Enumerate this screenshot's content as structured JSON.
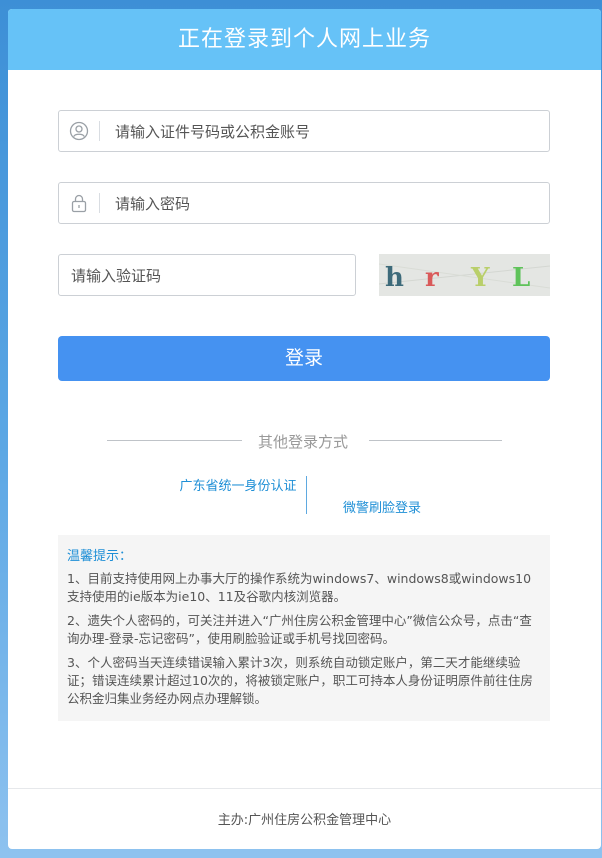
{
  "header": {
    "title": "正在登录到个人网上业务"
  },
  "form": {
    "account_placeholder": "请输入证件号码或公积金账号",
    "password_placeholder": "请输入密码",
    "captcha_placeholder": "请输入验证码",
    "captcha_chars": [
      "h",
      "r",
      "Y",
      "L"
    ],
    "captcha_colors": [
      "#3d6a7a",
      "#d95a5a",
      "#b9cf6a",
      "#5fc35a"
    ],
    "login_label": "登录"
  },
  "other_login": {
    "heading": "其他登录方式",
    "gd_auth_label": "广东省统一身份认证",
    "wechat_face_label": "微警刷脸登录"
  },
  "tips": {
    "title": "温馨提示：",
    "items": [
      "1、目前支持使用网上办事大厅的操作系统为windows7、windows8或windows10支持使用的ie版本为ie10、11及谷歌内核浏览器。",
      "2、遗失个人密码的，可关注并进入“广州住房公积金管理中心”微信公众号，点击“查询办理-登录-忘记密码”，使用刷脸验证或手机号找回密码。",
      "3、个人密码当天连续错误输入累计3次，则系统自动锁定账户，第二天才能继续验证；错误连续累计超过10次的，将被锁定账户，职工可持本人身份证明原件前往住房公积金归集业务经办网点办理解锁。"
    ]
  },
  "footer": {
    "text": "主办:广州住房公积金管理中心"
  },
  "colors": {
    "header": "#66c2f7",
    "button": "#4592f1",
    "link": "#1f8fd6"
  }
}
